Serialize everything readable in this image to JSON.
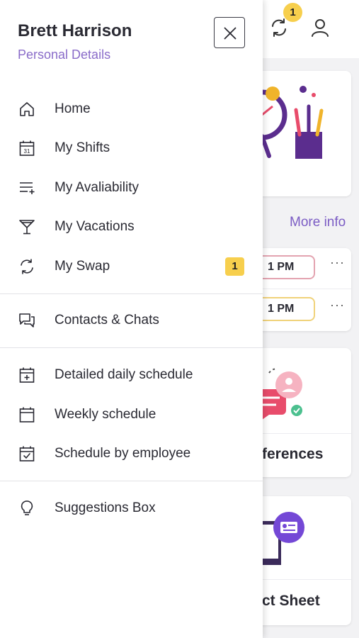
{
  "header": {
    "swap_badge": "1",
    "swap_icon": "swap-icon",
    "user_icon": "user-icon"
  },
  "background": {
    "more_info": "More info",
    "shift_times": [
      "1 PM",
      "1 PM"
    ],
    "more_label": "···",
    "card_titles": [
      "ferences",
      "ct Sheet"
    ]
  },
  "drawer": {
    "user_name": "Brett Harrison",
    "personal_details": "Personal Details",
    "close_icon": "close-icon",
    "sections": [
      [
        {
          "label": "Home",
          "icon": "home-icon"
        },
        {
          "label": "My Shifts",
          "icon": "calendar-31-icon"
        },
        {
          "label": "My Avaliability",
          "icon": "list-add-icon"
        },
        {
          "label": "My Vacations",
          "icon": "cocktail-icon"
        },
        {
          "label": "My Swap",
          "icon": "swap-icon",
          "badge": "1"
        }
      ],
      [
        {
          "label": "Contacts & Chats",
          "icon": "chat-icon"
        }
      ],
      [
        {
          "label": "Detailed daily schedule",
          "icon": "calendar-plus-icon"
        },
        {
          "label": "Weekly schedule",
          "icon": "calendar-icon"
        },
        {
          "label": "Schedule by employee",
          "icon": "calendar-check-icon"
        }
      ],
      [
        {
          "label": "Suggestions Box",
          "icon": "lightbulb-icon"
        }
      ]
    ]
  },
  "colors": {
    "accent_purple": "#8a6cc9",
    "badge_yellow": "#f7cf4d",
    "pill_red": "#e3a3b0",
    "pill_yellow": "#f0d27a"
  }
}
